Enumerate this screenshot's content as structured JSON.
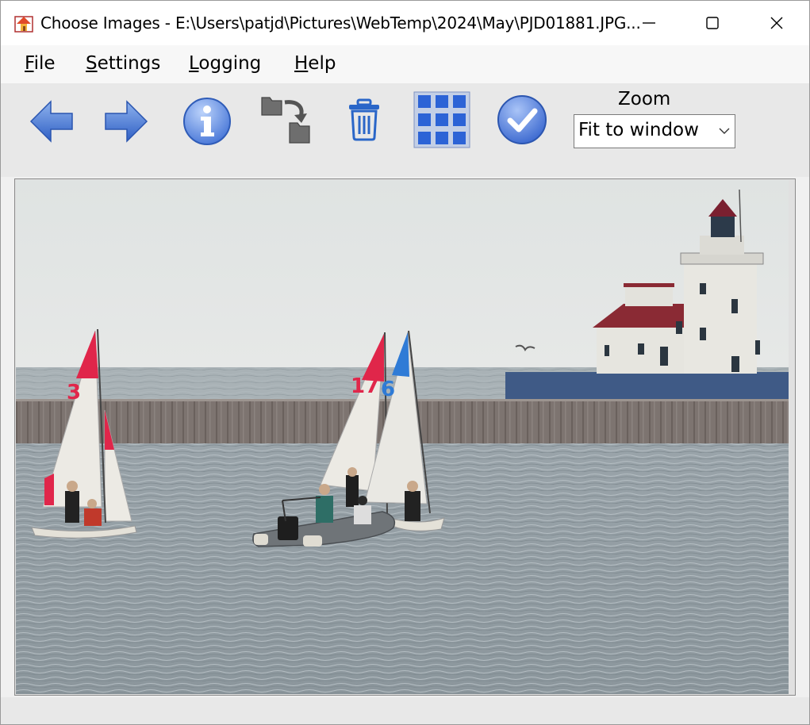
{
  "window": {
    "title": "Choose Images - E:\\Users\\patjd\\Pictures\\WebTemp\\2024\\May\\PJD01881.JPG..."
  },
  "menu": {
    "items": [
      {
        "label": "File"
      },
      {
        "label": "Settings"
      },
      {
        "label": "Logging"
      },
      {
        "label": "Help"
      }
    ]
  },
  "toolbar": {
    "buttons": [
      {
        "name": "previous",
        "icon": "arrow-left-icon"
      },
      {
        "name": "next",
        "icon": "arrow-right-icon"
      },
      {
        "name": "info",
        "icon": "info-icon"
      },
      {
        "name": "move",
        "icon": "folder-move-icon"
      },
      {
        "name": "delete",
        "icon": "trash-icon"
      },
      {
        "name": "thumbnails",
        "icon": "grid-icon"
      },
      {
        "name": "accept",
        "icon": "checkmark-icon"
      }
    ],
    "zoom": {
      "label": "Zoom",
      "selected": "Fit to window"
    }
  },
  "image": {
    "sail_numbers": [
      "3",
      "17",
      "6"
    ]
  },
  "colors": {
    "accent_blue": "#3f6fd1",
    "sail_red": "#e0264a",
    "sail_blue": "#2f7bd6"
  }
}
